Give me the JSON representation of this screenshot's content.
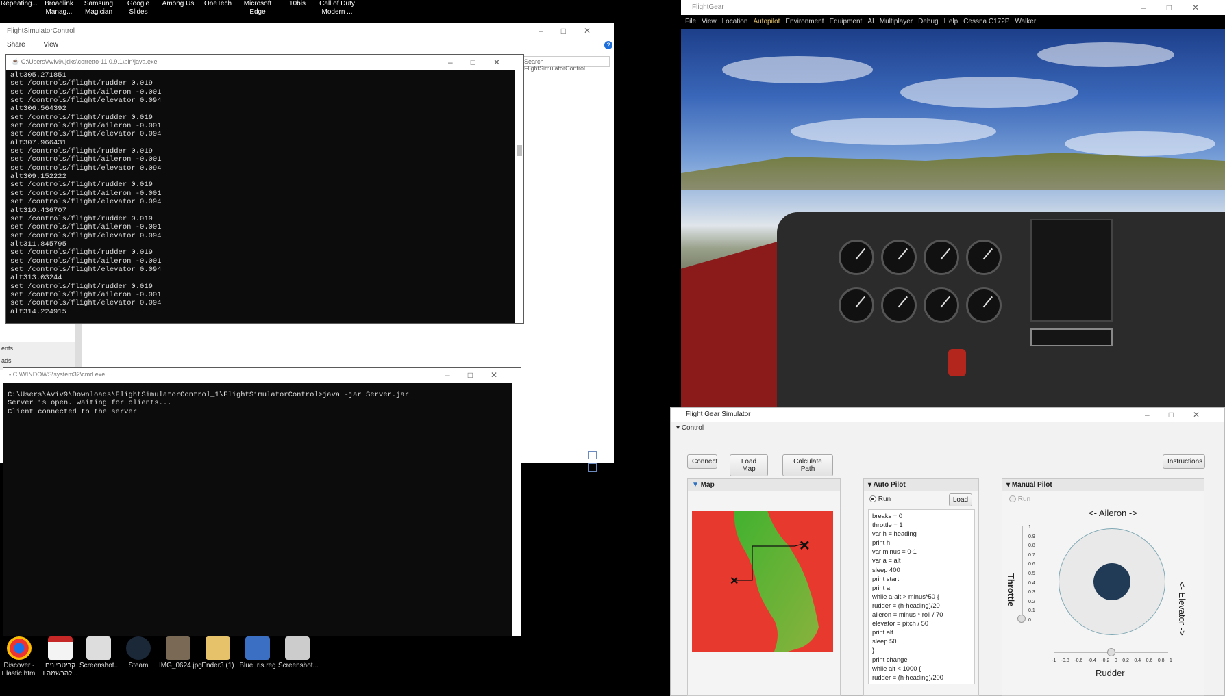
{
  "desktop_top_icons": [
    "Repeating...",
    "Broadlink Manag...",
    "Samsung Magician",
    "Google Slides",
    "Among Us",
    "OneTech",
    "Microsoft Edge",
    "10bis",
    "Call of Duty Modern ..."
  ],
  "desktop_bottom_icons": [
    "Discover - Elastic.html",
    "קריטריונים להרשמה ו...",
    "Screenshot...",
    "Steam",
    "IMG_0624.jpg",
    "Ender3 (1)",
    "Blue Iris.reg",
    "Screenshot..."
  ],
  "explorer": {
    "title": "FlightSimulatorControl",
    "ribbon": [
      "Share",
      "View"
    ],
    "search_placeholder": "Search FlightSimulatorControl",
    "side_items": [
      "ents",
      "ads"
    ]
  },
  "java_console": {
    "title": "C:\\Users\\Aviv9\\.jdks\\corretto-11.0.9.1\\bin\\java.exe",
    "lines": [
      "alt305.271851",
      "set /controls/flight/rudder 0.019",
      "set /controls/flight/aileron -0.001",
      "set /controls/flight/elevator 0.094",
      "alt306.564392",
      "set /controls/flight/rudder 0.019",
      "set /controls/flight/aileron -0.001",
      "set /controls/flight/elevator 0.094",
      "alt307.966431",
      "set /controls/flight/rudder 0.019",
      "set /controls/flight/aileron -0.001",
      "set /controls/flight/elevator 0.094",
      "alt309.152222",
      "set /controls/flight/rudder 0.019",
      "set /controls/flight/aileron -0.001",
      "set /controls/flight/elevator 0.094",
      "alt310.436707",
      "set /controls/flight/rudder 0.019",
      "set /controls/flight/aileron -0.001",
      "set /controls/flight/elevator 0.094",
      "alt311.845795",
      "set /controls/flight/rudder 0.019",
      "set /controls/flight/aileron -0.001",
      "set /controls/flight/elevator 0.094",
      "alt313.03244",
      "set /controls/flight/rudder 0.019",
      "set /controls/flight/aileron -0.001",
      "set /controls/flight/elevator 0.094",
      "alt314.224915"
    ]
  },
  "cmd_console": {
    "title": "C:\\WINDOWS\\system32\\cmd.exe",
    "lines": [
      "C:\\Users\\Aviv9\\Downloads\\FlightSimulatorControl_1\\FlightSimulatorControl>java -jar Server.jar",
      "Server is open. waiting for clients...",
      "Client connected to the server"
    ]
  },
  "flightgear": {
    "title": "FlightGear",
    "menu": [
      "File",
      "View",
      "Location",
      "Autopilot",
      "Environment",
      "Equipment",
      "AI",
      "Multiplayer",
      "Debug",
      "Help",
      "Cessna C172P",
      "Walker"
    ],
    "active_menu": "Autopilot"
  },
  "app": {
    "title": "Flight Gear Simulator",
    "section": "Control",
    "buttons": {
      "connect": "Connect",
      "load_map": "Load Map",
      "calc_path": "Calculate Path",
      "instructions": "Instructions",
      "load": "Load"
    },
    "map_title": "Map",
    "autopilot_title": "Auto Pilot",
    "manual_title": "Manual Pilot",
    "run_label": "Run",
    "autopilot_selected": true,
    "manual_selected": false,
    "script": [
      "breaks = 0",
      "throttle = 1",
      "var h = heading",
      "print h",
      "var minus = 0-1",
      "var a = alt",
      "sleep 400",
      "print start",
      "print a",
      "while a-alt > minus*50 {",
      "rudder = (h-heading)/20",
      "aileron = minus * roll / 70",
      "elevator = pitch / 50",
      "print alt",
      "sleep 50",
      "}",
      "print change",
      "while alt < 1000 {",
      "rudder = (h-heading)/200"
    ],
    "aileron_label": "<- Aileron ->",
    "elevator_label": "<- Elevator ->",
    "throttle_label": "Throttle",
    "rudder_label": "Rudder",
    "throttle_ticks": [
      "1",
      "0.9",
      "0.8",
      "0.7",
      "0.6",
      "0.5",
      "0.4",
      "0.3",
      "0.2",
      "0.1",
      "0"
    ],
    "rudder_ticks": [
      "-1",
      "-0.8",
      "-0.6",
      "-0.4",
      "-0.2",
      "0",
      "0.2",
      "0.4",
      "0.6",
      "0.8",
      "1"
    ],
    "throttle_value": 0,
    "rudder_value": 0
  }
}
